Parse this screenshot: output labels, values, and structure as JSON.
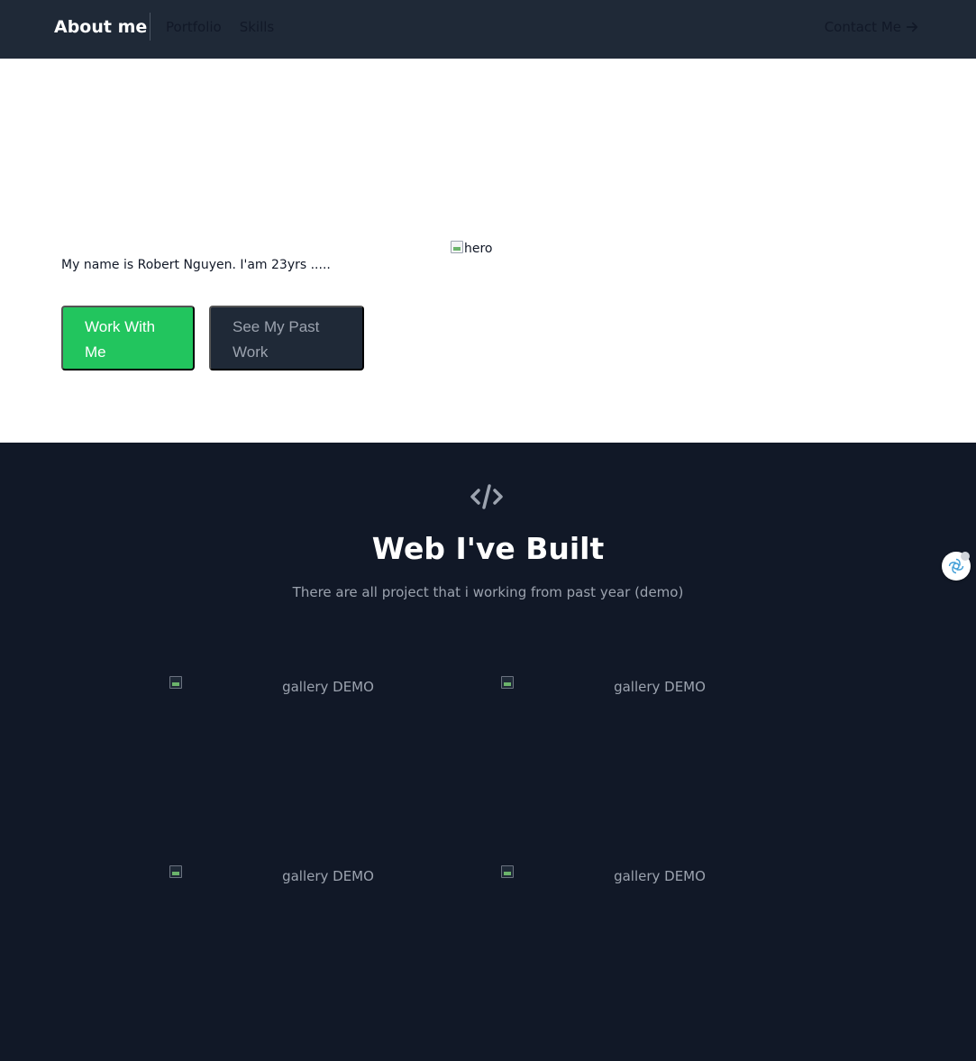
{
  "header": {
    "brand": "About me",
    "nav_links": [
      "Portfolio",
      "Skills"
    ],
    "contact": "Contact Me"
  },
  "hero": {
    "intro": "My name is Robert Nguyen. I'am 23yrs .....",
    "image_alt": "hero",
    "primary_button": "Work With Me",
    "secondary_button": "See My Past Work"
  },
  "projects": {
    "icon": "code-icon",
    "title": "Web I've Built",
    "subtitle": "There are all project that i working from past year (demo)",
    "gallery": [
      {
        "alt": "gallery DEMO"
      },
      {
        "alt": "gallery DEMO"
      },
      {
        "alt": "gallery DEMO"
      },
      {
        "alt": "gallery DEMO"
      }
    ]
  },
  "colors": {
    "nav_bg": "#1f2937",
    "accent": "#22c55e",
    "section_bg": "#111827"
  }
}
